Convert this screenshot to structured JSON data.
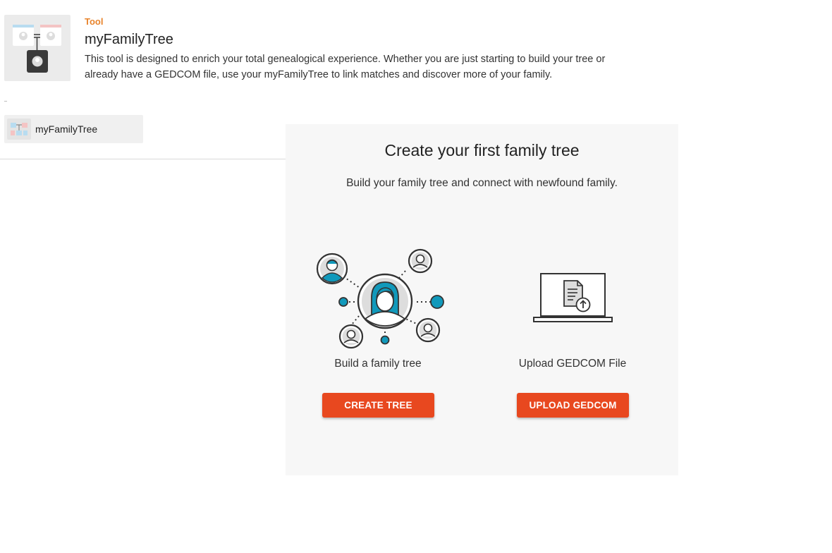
{
  "tool": {
    "kicker": "Tool",
    "title": "myFamilyTree",
    "description": "This tool is designed to enrich your total genealogical experience. Whether you are just starting to build your tree or already have a GEDCOM file, use your myFamilyTree to link matches and discover more of your family.",
    "icon": "family-tree-thumbnail-icon"
  },
  "sidebar": {
    "items": [
      {
        "label": "myFamilyTree",
        "icon": "family-tree-thumbnail-icon"
      }
    ]
  },
  "panel": {
    "title": "Create your first family tree",
    "subtitle": "Build your family tree and connect with newfound family.",
    "options": [
      {
        "label": "Build a family tree",
        "button": "CREATE TREE",
        "icon": "family-network-icon"
      },
      {
        "label": "Upload GEDCOM File",
        "button": "UPLOAD GEDCOM",
        "icon": "laptop-upload-icon"
      }
    ]
  },
  "colors": {
    "accent_orange": "#e8842c",
    "button_red": "#e8481f",
    "illustration_teal": "#1199bb",
    "panel_bg": "#f7f7f7"
  }
}
